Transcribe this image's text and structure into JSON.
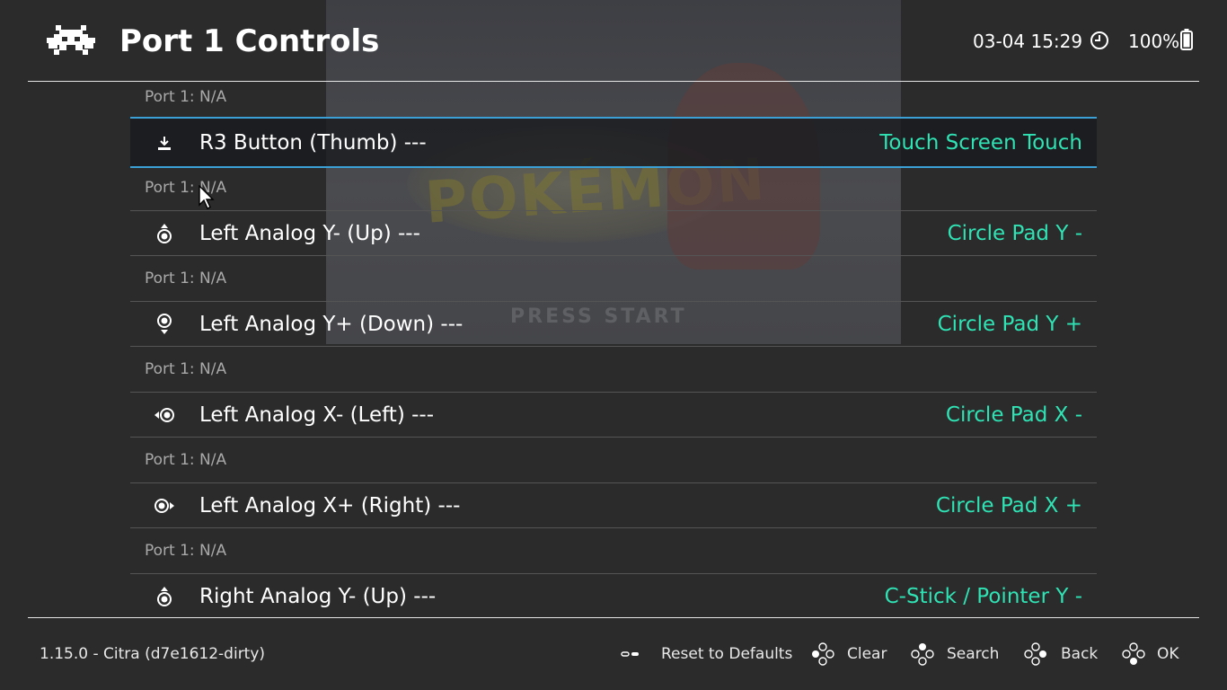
{
  "header": {
    "title": "Port 1 Controls",
    "clock": "03-04 15:29",
    "battery": "100%",
    "icons": {
      "logo": "retroarch-invader-icon",
      "clock": "clock-icon",
      "battery": "battery-icon"
    }
  },
  "background": {
    "press_start": "PRESS START"
  },
  "list": {
    "items": [
      {
        "sublabel": "Port 1: N/A"
      },
      {
        "label": "R3 Button (Thumb) ---",
        "value": "Touch Screen Touch",
        "icon": "r3-button-icon",
        "selected": true
      },
      {
        "sublabel": "Port 1: N/A"
      },
      {
        "label": "Left Analog Y- (Up) ---",
        "value": "Circle Pad Y -",
        "icon": "left-stick-up-icon"
      },
      {
        "sublabel": "Port 1: N/A"
      },
      {
        "label": "Left Analog Y+ (Down) ---",
        "value": "Circle Pad Y +",
        "icon": "left-stick-down-icon"
      },
      {
        "sublabel": "Port 1: N/A"
      },
      {
        "label": "Left Analog X- (Left) ---",
        "value": "Circle Pad X -",
        "icon": "left-stick-left-icon"
      },
      {
        "sublabel": "Port 1: N/A"
      },
      {
        "label": "Left Analog X+ (Right) ---",
        "value": "Circle Pad X +",
        "icon": "left-stick-right-icon"
      },
      {
        "sublabel": "Port 1: N/A"
      },
      {
        "label": "Right Analog Y- (Up) ---",
        "value": "C-Stick / Pointer Y -",
        "icon": "right-stick-up-icon"
      }
    ]
  },
  "footer": {
    "version": "1.15.0 - Citra (d7e1612-dirty)",
    "buttons": [
      {
        "label": "Reset to Defaults",
        "icon": "select-button-icon"
      },
      {
        "label": "Clear",
        "icon": "dpad-west-button-icon"
      },
      {
        "label": "Search",
        "icon": "dpad-north-button-icon"
      },
      {
        "label": "Back",
        "icon": "dpad-east-button-icon"
      },
      {
        "label": "OK",
        "icon": "dpad-south-button-icon"
      }
    ]
  },
  "colors": {
    "background": "#2b2b2b",
    "value_text": "#2fe3b4",
    "selection_border": "#3aa0d6",
    "sublabel_text": "#a9a9a9"
  }
}
